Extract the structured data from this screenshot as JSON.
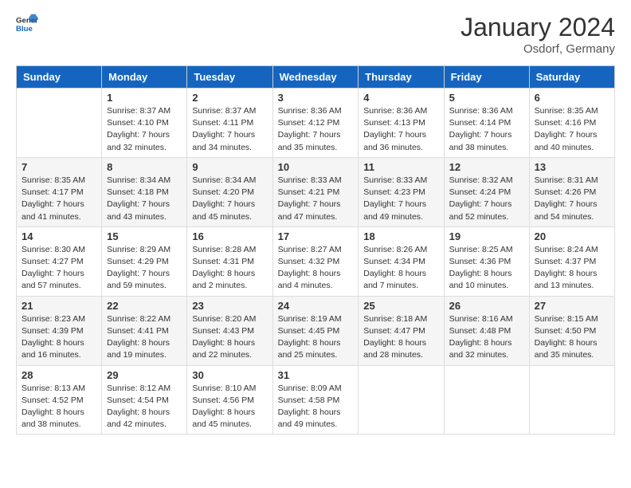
{
  "header": {
    "logo_general": "General",
    "logo_blue": "Blue",
    "month": "January 2024",
    "location": "Osdorf, Germany"
  },
  "weekdays": [
    "Sunday",
    "Monday",
    "Tuesday",
    "Wednesday",
    "Thursday",
    "Friday",
    "Saturday"
  ],
  "weeks": [
    [
      {
        "day": "",
        "info": ""
      },
      {
        "day": "1",
        "info": "Sunrise: 8:37 AM\nSunset: 4:10 PM\nDaylight: 7 hours\nand 32 minutes."
      },
      {
        "day": "2",
        "info": "Sunrise: 8:37 AM\nSunset: 4:11 PM\nDaylight: 7 hours\nand 34 minutes."
      },
      {
        "day": "3",
        "info": "Sunrise: 8:36 AM\nSunset: 4:12 PM\nDaylight: 7 hours\nand 35 minutes."
      },
      {
        "day": "4",
        "info": "Sunrise: 8:36 AM\nSunset: 4:13 PM\nDaylight: 7 hours\nand 36 minutes."
      },
      {
        "day": "5",
        "info": "Sunrise: 8:36 AM\nSunset: 4:14 PM\nDaylight: 7 hours\nand 38 minutes."
      },
      {
        "day": "6",
        "info": "Sunrise: 8:35 AM\nSunset: 4:16 PM\nDaylight: 7 hours\nand 40 minutes."
      }
    ],
    [
      {
        "day": "7",
        "info": "Sunrise: 8:35 AM\nSunset: 4:17 PM\nDaylight: 7 hours\nand 41 minutes."
      },
      {
        "day": "8",
        "info": "Sunrise: 8:34 AM\nSunset: 4:18 PM\nDaylight: 7 hours\nand 43 minutes."
      },
      {
        "day": "9",
        "info": "Sunrise: 8:34 AM\nSunset: 4:20 PM\nDaylight: 7 hours\nand 45 minutes."
      },
      {
        "day": "10",
        "info": "Sunrise: 8:33 AM\nSunset: 4:21 PM\nDaylight: 7 hours\nand 47 minutes."
      },
      {
        "day": "11",
        "info": "Sunrise: 8:33 AM\nSunset: 4:23 PM\nDaylight: 7 hours\nand 49 minutes."
      },
      {
        "day": "12",
        "info": "Sunrise: 8:32 AM\nSunset: 4:24 PM\nDaylight: 7 hours\nand 52 minutes."
      },
      {
        "day": "13",
        "info": "Sunrise: 8:31 AM\nSunset: 4:26 PM\nDaylight: 7 hours\nand 54 minutes."
      }
    ],
    [
      {
        "day": "14",
        "info": "Sunrise: 8:30 AM\nSunset: 4:27 PM\nDaylight: 7 hours\nand 57 minutes."
      },
      {
        "day": "15",
        "info": "Sunrise: 8:29 AM\nSunset: 4:29 PM\nDaylight: 7 hours\nand 59 minutes."
      },
      {
        "day": "16",
        "info": "Sunrise: 8:28 AM\nSunset: 4:31 PM\nDaylight: 8 hours\nand 2 minutes."
      },
      {
        "day": "17",
        "info": "Sunrise: 8:27 AM\nSunset: 4:32 PM\nDaylight: 8 hours\nand 4 minutes."
      },
      {
        "day": "18",
        "info": "Sunrise: 8:26 AM\nSunset: 4:34 PM\nDaylight: 8 hours\nand 7 minutes."
      },
      {
        "day": "19",
        "info": "Sunrise: 8:25 AM\nSunset: 4:36 PM\nDaylight: 8 hours\nand 10 minutes."
      },
      {
        "day": "20",
        "info": "Sunrise: 8:24 AM\nSunset: 4:37 PM\nDaylight: 8 hours\nand 13 minutes."
      }
    ],
    [
      {
        "day": "21",
        "info": "Sunrise: 8:23 AM\nSunset: 4:39 PM\nDaylight: 8 hours\nand 16 minutes."
      },
      {
        "day": "22",
        "info": "Sunrise: 8:22 AM\nSunset: 4:41 PM\nDaylight: 8 hours\nand 19 minutes."
      },
      {
        "day": "23",
        "info": "Sunrise: 8:20 AM\nSunset: 4:43 PM\nDaylight: 8 hours\nand 22 minutes."
      },
      {
        "day": "24",
        "info": "Sunrise: 8:19 AM\nSunset: 4:45 PM\nDaylight: 8 hours\nand 25 minutes."
      },
      {
        "day": "25",
        "info": "Sunrise: 8:18 AM\nSunset: 4:47 PM\nDaylight: 8 hours\nand 28 minutes."
      },
      {
        "day": "26",
        "info": "Sunrise: 8:16 AM\nSunset: 4:48 PM\nDaylight: 8 hours\nand 32 minutes."
      },
      {
        "day": "27",
        "info": "Sunrise: 8:15 AM\nSunset: 4:50 PM\nDaylight: 8 hours\nand 35 minutes."
      }
    ],
    [
      {
        "day": "28",
        "info": "Sunrise: 8:13 AM\nSunset: 4:52 PM\nDaylight: 8 hours\nand 38 minutes."
      },
      {
        "day": "29",
        "info": "Sunrise: 8:12 AM\nSunset: 4:54 PM\nDaylight: 8 hours\nand 42 minutes."
      },
      {
        "day": "30",
        "info": "Sunrise: 8:10 AM\nSunset: 4:56 PM\nDaylight: 8 hours\nand 45 minutes."
      },
      {
        "day": "31",
        "info": "Sunrise: 8:09 AM\nSunset: 4:58 PM\nDaylight: 8 hours\nand 49 minutes."
      },
      {
        "day": "",
        "info": ""
      },
      {
        "day": "",
        "info": ""
      },
      {
        "day": "",
        "info": ""
      }
    ]
  ]
}
